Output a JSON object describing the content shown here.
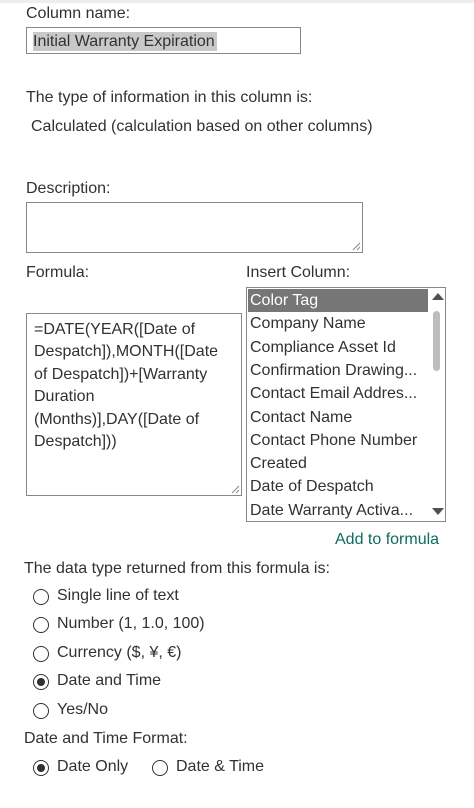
{
  "column_name": {
    "label": "Column name:",
    "value": "Initial Warranty Expiration"
  },
  "info_type": {
    "label": "The type of information in this column is:",
    "value": "Calculated (calculation based on other columns)"
  },
  "description": {
    "label": "Description:",
    "value": ""
  },
  "formula": {
    "label": "Formula:",
    "value": "=DATE(YEAR([Date of Despatch]),MONTH([Date of Despatch])+[Warranty Duration (Months)],DAY([Date of Despatch]))"
  },
  "insert_column": {
    "label": "Insert Column:",
    "items": [
      "Color Tag",
      "Company Name",
      "Compliance Asset Id",
      "Confirmation Drawing...",
      "Contact Email Addres...",
      "Contact Name",
      "Contact Phone Number",
      "Created",
      "Date of Despatch",
      "Date Warranty Activa..."
    ],
    "selected": "Color Tag",
    "add_link": "Add to formula"
  },
  "data_type": {
    "label": "The data type returned from this formula is:",
    "options": [
      "Single line of text",
      "Number (1, 1.0, 100)",
      "Currency ($, ¥, €)",
      "Date and Time",
      "Yes/No"
    ],
    "selected": "Date and Time"
  },
  "date_format": {
    "label": "Date and Time Format:",
    "options": [
      "Date Only",
      "Date & Time"
    ],
    "selected": "Date Only"
  },
  "colors": {
    "accent_link": "#0f6c5c",
    "selected_item_bg": "#767676",
    "text": "#323130"
  }
}
